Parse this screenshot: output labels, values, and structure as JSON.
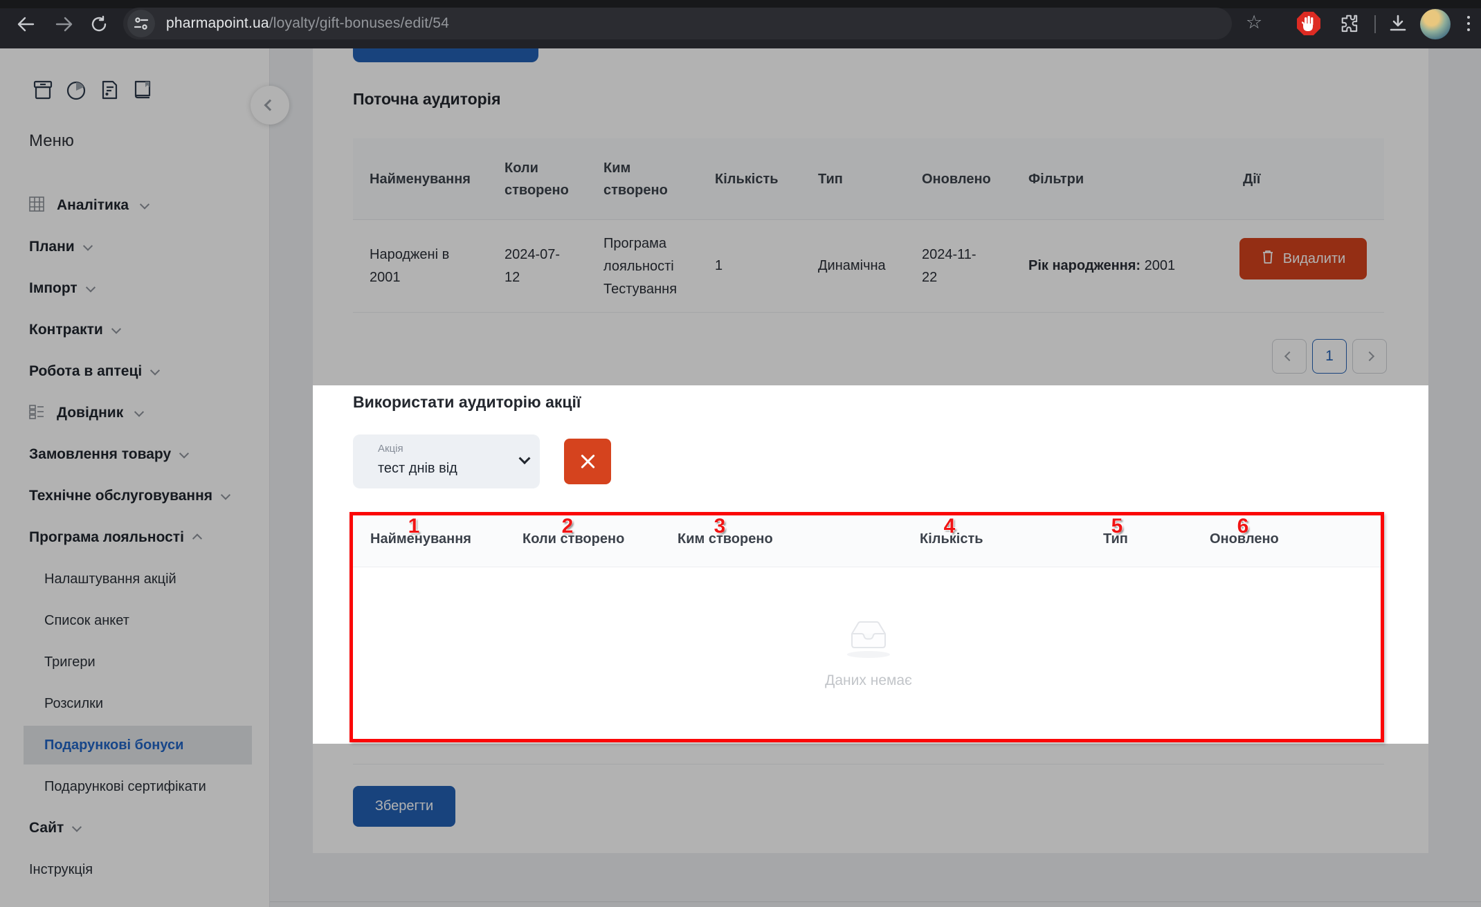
{
  "browser": {
    "url_host": "pharmapoint.ua",
    "url_path": "/loyalty/gift-bonuses/edit/54"
  },
  "sidebar": {
    "menu_title": "Меню",
    "items": [
      {
        "label": "Аналітика"
      },
      {
        "label": "Плани"
      },
      {
        "label": "Імпорт"
      },
      {
        "label": "Контракти"
      },
      {
        "label": "Робота в аптеці"
      },
      {
        "label": "Довідник"
      },
      {
        "label": "Замовлення товару"
      },
      {
        "label": "Технічне обслуговування"
      },
      {
        "label": "Програма лояльності"
      },
      {
        "label": "Налаштування акцій"
      },
      {
        "label": "Список анкет"
      },
      {
        "label": "Тригери"
      },
      {
        "label": "Розсилки"
      },
      {
        "label": "Подарункові бонуси"
      },
      {
        "label": "Подарункові сертифікати"
      },
      {
        "label": "Сайт"
      },
      {
        "label": "Інструкція"
      }
    ]
  },
  "main": {
    "current_audience": {
      "title": "Поточна аудиторія",
      "headers": [
        "Найменування",
        "Коли створено",
        "Ким створено",
        "Кількість",
        "Тип",
        "Оновлено",
        "Фільтри",
        "Дії"
      ],
      "row": {
        "name": "Народжені в 2001",
        "created": "2024-07-12",
        "creator": "Програма лояльності Тестування",
        "count": "1",
        "type": "Динамічна",
        "updated": "2024-11-22",
        "filter_label": "Рік народження:",
        "filter_value": "2001"
      },
      "delete_label": "Видалити",
      "pagination": {
        "page": "1"
      }
    },
    "use_audience": {
      "title": "Використати аудиторію акції",
      "select_label": "Акція",
      "select_value": "тест днів від",
      "headers": [
        "Найменування",
        "Коли створено",
        "Ким створено",
        "Кількість",
        "Тип",
        "Оновлено"
      ],
      "empty_text": "Даних немає",
      "save_label": "Зберегти"
    }
  },
  "annotations": {
    "marks": [
      "1",
      "2",
      "3",
      "4",
      "5",
      "6"
    ],
    "colors": {
      "annotation_red": "#f01414",
      "accent_blue": "#2361b4",
      "danger_red": "#d5431e",
      "link_blue": "#2265c4"
    }
  }
}
